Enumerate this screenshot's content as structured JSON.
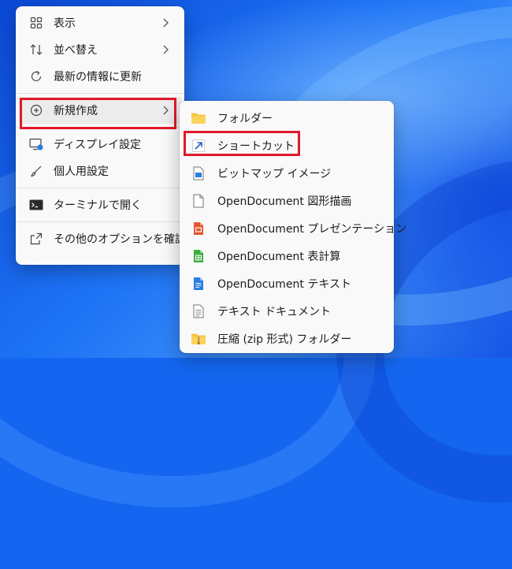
{
  "main_menu": {
    "items": [
      {
        "label": "表示",
        "icon": "grid-view-icon",
        "submenu": true
      },
      {
        "label": "並べ替え",
        "icon": "sort-icon",
        "submenu": true
      },
      {
        "label": "最新の情報に更新",
        "icon": "refresh-icon",
        "submenu": false
      },
      {
        "label": "新規作成",
        "icon": "new-plus-icon",
        "submenu": true,
        "highlighted": true
      },
      {
        "label": "ディスプレイ設定",
        "icon": "display-settings-icon",
        "submenu": false
      },
      {
        "label": "個人用設定",
        "icon": "personalize-brush-icon",
        "submenu": false
      },
      {
        "label": "ターミナルで開く",
        "icon": "terminal-icon",
        "submenu": false
      },
      {
        "label": "その他のオプションを確認",
        "icon": "more-options-icon",
        "submenu": false
      }
    ]
  },
  "sub_menu": {
    "items": [
      {
        "label": "フォルダー",
        "icon": "folder-icon"
      },
      {
        "label": "ショートカット",
        "icon": "shortcut-arrow-icon",
        "boxed": true
      },
      {
        "label": "ビットマップ イメージ",
        "icon": "bitmap-image-icon"
      },
      {
        "label": "OpenDocument 図形描画",
        "icon": "document-blank-icon"
      },
      {
        "label": "OpenDocument プレゼンテーション",
        "icon": "presentation-icon"
      },
      {
        "label": "OpenDocument 表計算",
        "icon": "spreadsheet-icon"
      },
      {
        "label": "OpenDocument テキスト",
        "icon": "text-document-icon"
      },
      {
        "label": "テキスト ドキュメント",
        "icon": "text-file-icon"
      },
      {
        "label": "圧縮 (zip 形式) フォルダー",
        "icon": "zip-folder-icon"
      }
    ]
  },
  "colors": {
    "highlight_box": "#e2182b",
    "menu_bg": "#f9f9f9",
    "folder": "#f6c344",
    "presentation": "#e4572e",
    "spreadsheet": "#3cae3e",
    "text_doc": "#2a7de1"
  }
}
